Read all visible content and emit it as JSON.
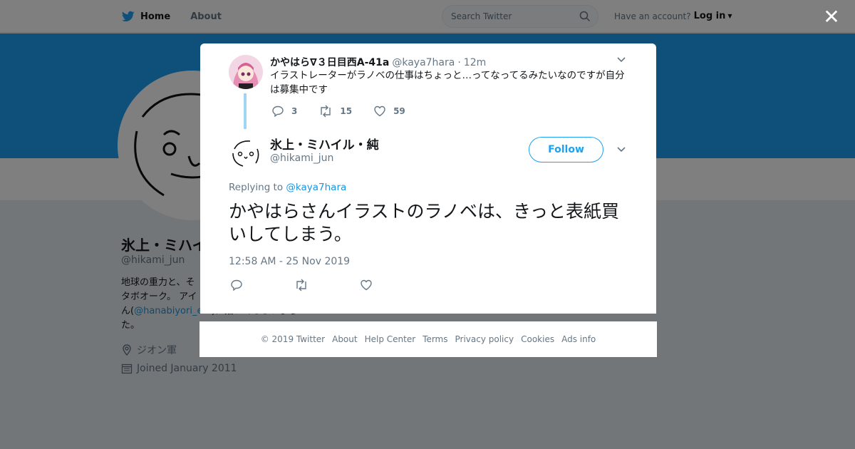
{
  "nav": {
    "home_label": "Home",
    "about_label": "About",
    "search_placeholder": "Search Twitter",
    "account_prompt": "Have an account?",
    "login_label": "Log in"
  },
  "profile": {
    "name": "氷上・ミハイル・純",
    "handle": "@hikami_jun",
    "bio_prefix": "地球の重力と、そ",
    "bio_line2": "タボオーク。 アイ",
    "bio_line3_pre": "ん(",
    "bio_link": "@hanabiyori_e...",
    "bio_line3_post": ")に描いてもらいまし",
    "bio_line4": "た。",
    "location": "ジオン軍",
    "joined": "Joined January 2011"
  },
  "parent_tweet": {
    "name": "かやはら∇３日目西A-41a",
    "handle": "@kaya7hara",
    "dot": "·",
    "time": "12m",
    "text": "イラストレーターがラノベの仕事はちょっと…ってなってるみたいなのですが自分は募集中です",
    "replies": "3",
    "retweets": "15",
    "likes": "59"
  },
  "main_tweet": {
    "name": "氷上・ミハイル・純",
    "handle": "@hikami_jun",
    "follow_label": "Follow",
    "replying_prefix": "Replying to",
    "replying_to": "@kaya7hara",
    "text": "かやはらさんイラストのラノベは、きっと表紙買いしてしまう。",
    "timestamp": "12:58 AM - 25 Nov 2019"
  },
  "footer": {
    "copyright": "© 2019 Twitter",
    "about": "About",
    "help": "Help Center",
    "terms": "Terms",
    "privacy": "Privacy policy",
    "cookies": "Cookies",
    "ads": "Ads info"
  },
  "colors": {
    "accent": "#1da1f2",
    "link": "#1b95e0",
    "muted": "#657786"
  }
}
